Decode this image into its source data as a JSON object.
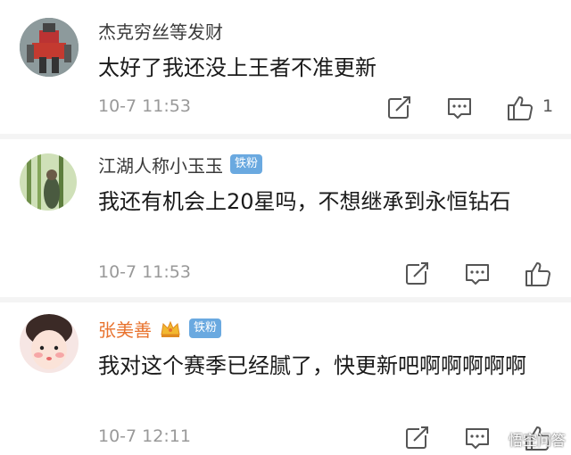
{
  "comments": [
    {
      "username": "杰克穷丝等发财",
      "text": "太好了我还没上王者不准更新",
      "time": "10-7 11:53",
      "likes": "1",
      "avatar_icon": "robot-avatar"
    },
    {
      "username": "江湖人称小玉玉",
      "badge": "铁粉",
      "text": "我还有机会上20星吗，不想继承到永恒钻石",
      "time": "10-7 11:53",
      "avatar_icon": "bamboo-avatar"
    },
    {
      "username": "张美善",
      "badge": "铁粉",
      "text": "我对这个赛季已经腻了，快更新吧啊啊啊啊啊",
      "time": "10-7 12:11",
      "avatar_icon": "girl-avatar"
    }
  ],
  "icons": {
    "share": "share-icon",
    "comment": "comment-icon",
    "like": "thumbs-up-icon"
  },
  "colors": {
    "badge": "#6aa9e0",
    "vip_name": "#e8722d",
    "time": "#999999"
  },
  "watermark": "悟空问答"
}
